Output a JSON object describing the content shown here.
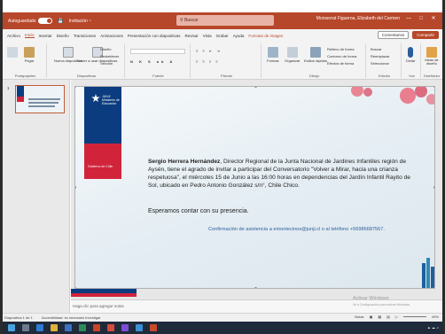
{
  "window": {
    "autosave_label": "Autoguardado",
    "file_name": "Invitación ~",
    "search_placeholder": "Buscar",
    "user_name": "Monserrat Figueroa, Elizabeth del Carmen"
  },
  "tabs": [
    {
      "label": "Archivo"
    },
    {
      "label": "Inicio"
    },
    {
      "label": "Insertar"
    },
    {
      "label": "Diseño"
    },
    {
      "label": "Transiciones"
    },
    {
      "label": "Animaciones"
    },
    {
      "label": "Presentación con diapositivas"
    },
    {
      "label": "Revisar"
    },
    {
      "label": "Vista"
    },
    {
      "label": "Grabar"
    },
    {
      "label": "Ayuda"
    },
    {
      "label": "Formato de imagen"
    }
  ],
  "tabs_right": {
    "comments": "Comentarios",
    "share": "Compartir"
  },
  "ribbon": {
    "groups": [
      "Portapapeles",
      "Diapositivas",
      "Fuente",
      "Párrafo",
      "Dibujo",
      "Edición",
      "Voz",
      "Diseñador"
    ],
    "buttons": {
      "paste": "Pegar",
      "new_slide": "Nueva diapositiva",
      "reuse": "Volver a usar diapositivas",
      "layout": "Diseño",
      "reset": "Restablecer",
      "section": "Sección",
      "shapes": "Formas",
      "arrange": "Organizar",
      "quick_styles": "Estilos rápidos",
      "shape_fill": "Relleno de forma",
      "shape_outline": "Contorno de forma",
      "shape_effects": "Efectos de forma",
      "find": "Buscar",
      "replace": "Reemplazar",
      "select": "Seleccionar",
      "dictate": "Dictar",
      "designer": "Ideas de diseño"
    }
  },
  "thumbnails": [
    {
      "number": "1"
    }
  ],
  "slide": {
    "logo_text": "JUNJI Ministerio de Educación",
    "logo_footer": "Gobierno de Chile",
    "body_bold": "Sergio Herrera Hernández",
    "body_rest": ", Director Regional de la Junta Nacional de Jardines Infantiles región de Aysén, tiene el agrado de invitar a participar del Conversatorio \"Volver a Mirar, hacia una crianza respetuosa\", el miércoles 15 de Junio a las 16:00 horas en dependencias del Jardín Infantil Rayito de Sol, ubicado en  Pedro Antonio González s/n°, Chile Chico.",
    "closing": "Esperamos contar con su presencia.",
    "confirm": "Confirmación de asistencia a emontecinos@junji.cl o al teléfono +56986687567."
  },
  "notes_placeholder": "Haga clic para agregar notas",
  "watermark": {
    "title": "Activar Windows",
    "sub": "Ve a Configuración para activar Windows."
  },
  "status": {
    "slide_count": "Diapositiva 1 de 1",
    "accessibility": "Accesibilidad: es necesario investigar",
    "notes_button": "Notas",
    "zoom": "49%"
  },
  "colors": {
    "accent": "#b7472a",
    "brand_blue": "#0b3c7f",
    "brand_red": "#d1243a",
    "link": "#2f5f9c"
  }
}
